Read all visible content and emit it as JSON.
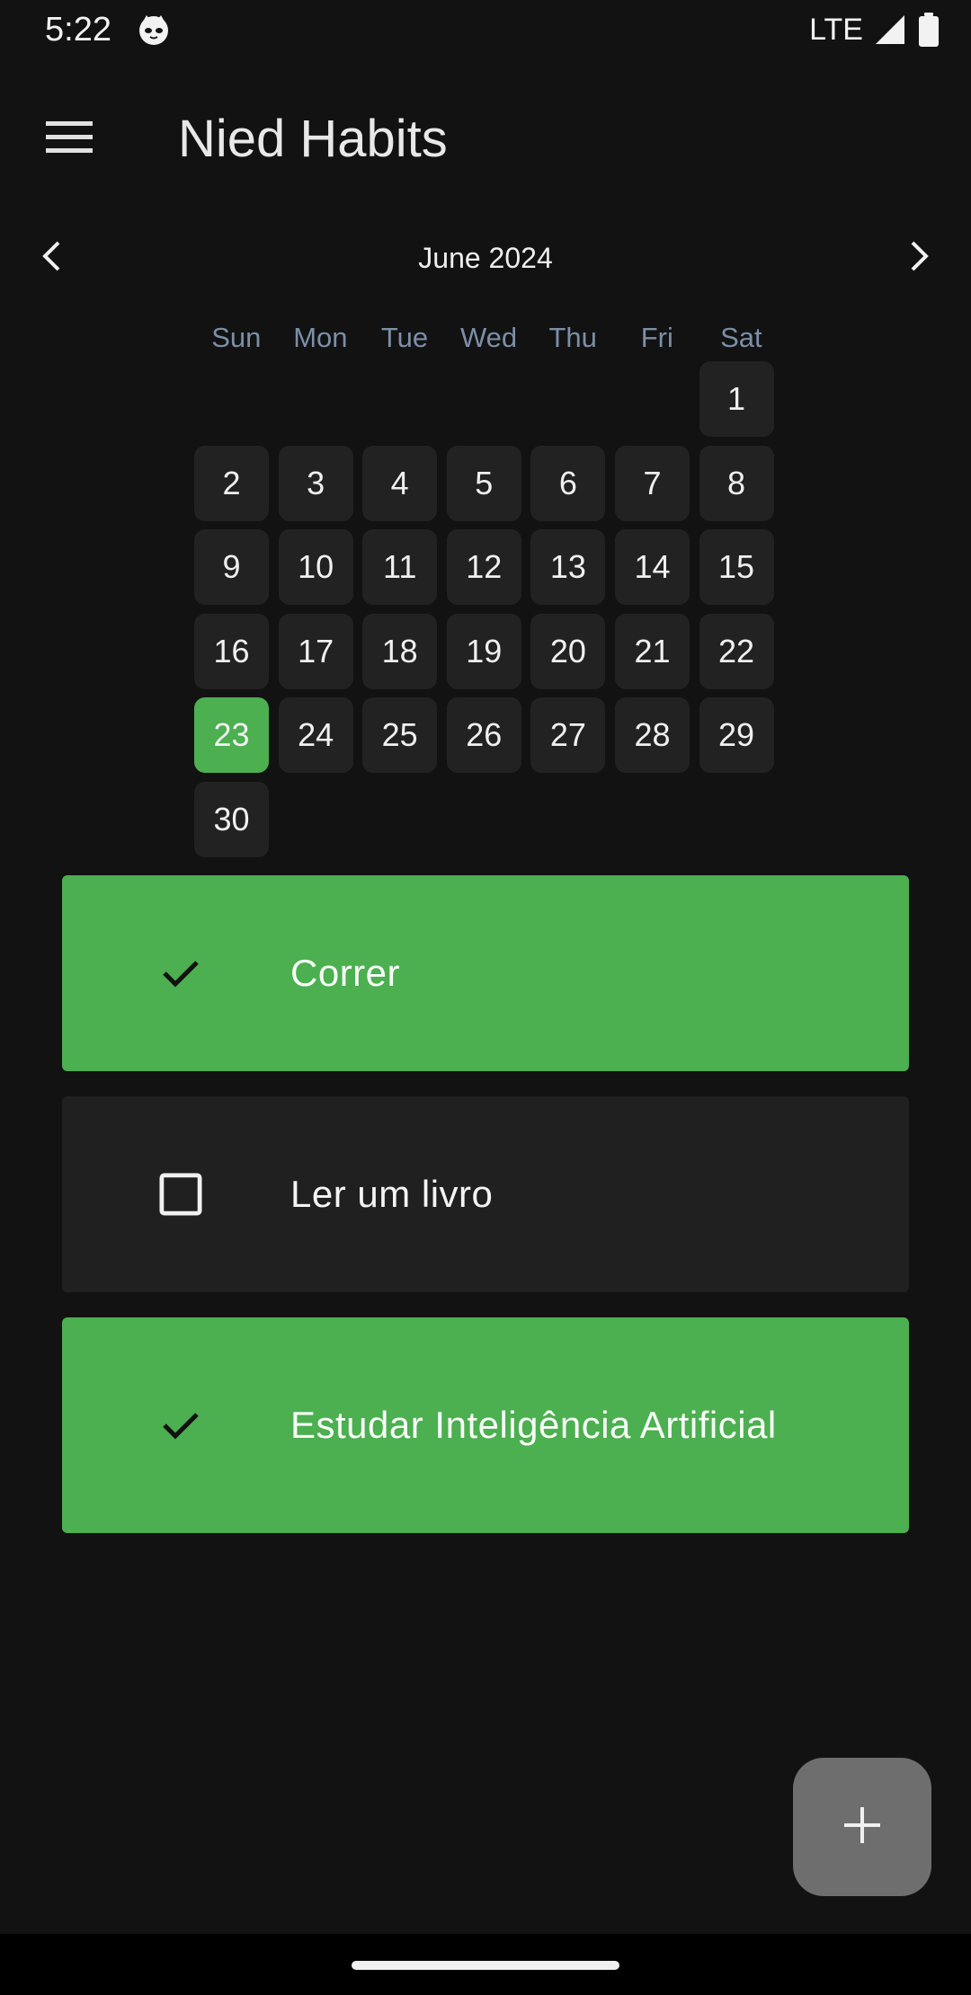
{
  "status_bar": {
    "time": "5:22",
    "network": "LTE",
    "icons": [
      "cat-notification-icon",
      "signal-icon",
      "battery-icon"
    ]
  },
  "app_bar": {
    "title": "Nied Habits",
    "menu_icon": "hamburger-menu-icon"
  },
  "calendar": {
    "month_label": "June 2024",
    "prev_icon": "chevron-left-icon",
    "next_icon": "chevron-right-icon",
    "weekdays": [
      "Sun",
      "Mon",
      "Tue",
      "Wed",
      "Thu",
      "Fri",
      "Sat"
    ],
    "leading_blanks": 6,
    "days": [
      "1",
      "2",
      "3",
      "4",
      "5",
      "6",
      "7",
      "8",
      "9",
      "10",
      "11",
      "12",
      "13",
      "14",
      "15",
      "16",
      "17",
      "18",
      "19",
      "20",
      "21",
      "22",
      "23",
      "24",
      "25",
      "26",
      "27",
      "28",
      "29",
      "30"
    ],
    "selected_day": "23",
    "selected_color": "#4caf50"
  },
  "habits": [
    {
      "label": "Correr",
      "done": true
    },
    {
      "label": "Ler um livro",
      "done": false
    },
    {
      "label": "Estudar Inteligência Artificial",
      "done": true
    }
  ],
  "fab": {
    "icon": "plus-icon"
  },
  "colors": {
    "background": "#121212",
    "accent": "#4caf50",
    "card_inactive": "#202020",
    "fab": "#6e6e6e"
  }
}
